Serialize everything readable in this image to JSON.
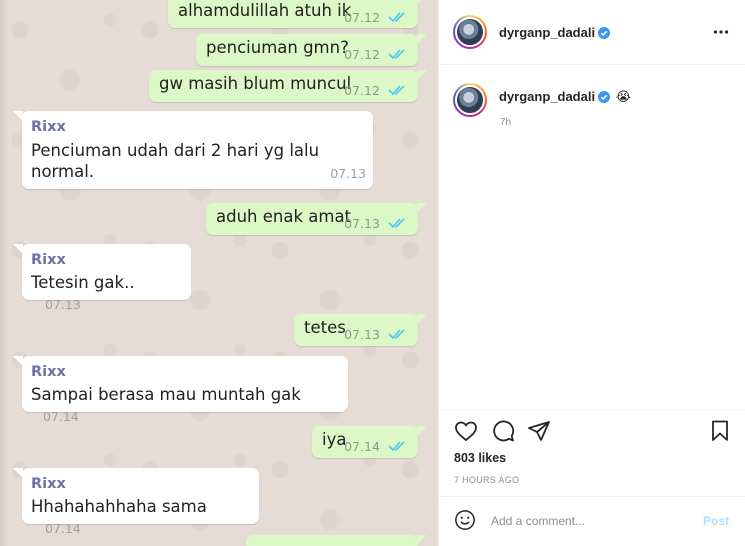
{
  "chat": {
    "messages": [
      {
        "direction": "out",
        "text": "alhamdulillah atuh ik",
        "time": "07.12",
        "status": "read"
      },
      {
        "direction": "out",
        "text": "penciuman gmn?",
        "time": "07.12",
        "status": "read"
      },
      {
        "direction": "out",
        "text": "gw masih blum muncul",
        "time": "07.12",
        "status": "read"
      },
      {
        "direction": "in",
        "sender": "Rixx",
        "text_line1": "Penciuman udah dari 2 hari yg lalu",
        "text_line2": "normal.",
        "time": "07.13"
      },
      {
        "direction": "out",
        "text": "aduh enak amat",
        "time": "07.13",
        "status": "read"
      },
      {
        "direction": "in",
        "sender": "Rixx",
        "text": "Tetesin gak..",
        "time": "07.13"
      },
      {
        "direction": "out",
        "text": "tetes",
        "time": "07.13",
        "status": "read"
      },
      {
        "direction": "in",
        "sender": "Rixx",
        "text": "Sampai berasa mau muntah gak",
        "time": "07.14"
      },
      {
        "direction": "out",
        "text": "iya",
        "time": "07.14",
        "status": "read"
      },
      {
        "direction": "in",
        "sender": "Rixx",
        "text": "Hhahahahhaha sama",
        "time": "07.14"
      }
    ],
    "colors": {
      "outgoing": "#dcf8c6",
      "incoming": "#ffffff",
      "background": "#e5ddd5",
      "sender": "#6b73a8",
      "ticks": "#4fc3f7"
    }
  },
  "instagram": {
    "header": {
      "username": "dyrganp_dadali",
      "verified": true,
      "more_icon": "more-horizontal-icon"
    },
    "caption": {
      "username": "dyrganp_dadali",
      "emoji": "😭",
      "time_ago": "7h"
    },
    "actions": {
      "like_icon": "heart-icon",
      "comment_icon": "comment-icon",
      "share_icon": "share-icon",
      "save_icon": "bookmark-icon"
    },
    "likes": "803 likes",
    "post_time": "7 HOURS AGO",
    "comment": {
      "placeholder": "Add a comment...",
      "post_label": "Post",
      "emoji_icon": "smiley-icon"
    },
    "colors": {
      "verified": "#3897f0",
      "post_button": "#b2dffc"
    }
  }
}
